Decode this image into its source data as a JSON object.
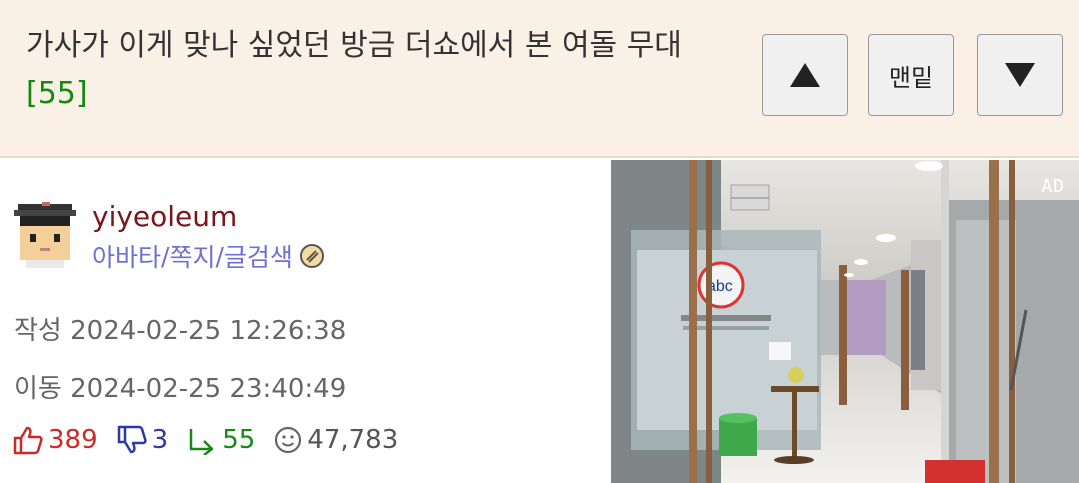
{
  "post": {
    "title": "가사가 이게 맞나 싶었던 방금 더쇼에서 본 여돌 무대",
    "reply_count": "[55]"
  },
  "nav": {
    "up_icon": "triangle-up-icon",
    "bottom_label": "맨밑",
    "down_icon": "triangle-down-icon"
  },
  "author": {
    "username": "yiyeoleum",
    "links": [
      "아바타",
      "쪽지",
      "글검색"
    ],
    "link_separator": "/"
  },
  "meta": {
    "written_label": "작성",
    "written_value": "2024-02-25 12:26:38",
    "moved_label": "이동",
    "moved_value": "2024-02-25 23:40:49"
  },
  "stats": {
    "likes": "389",
    "dislikes": "3",
    "replies": "55",
    "views": "47,783"
  },
  "ad": {
    "label": "AD"
  },
  "colors": {
    "title_bg": "#fbf0e6",
    "username": "#7a1518",
    "links": "#6f6fd6",
    "reply_green": "#148a14",
    "like_red": "#cc2a2a",
    "dislike_blue": "#2b3aa8"
  }
}
